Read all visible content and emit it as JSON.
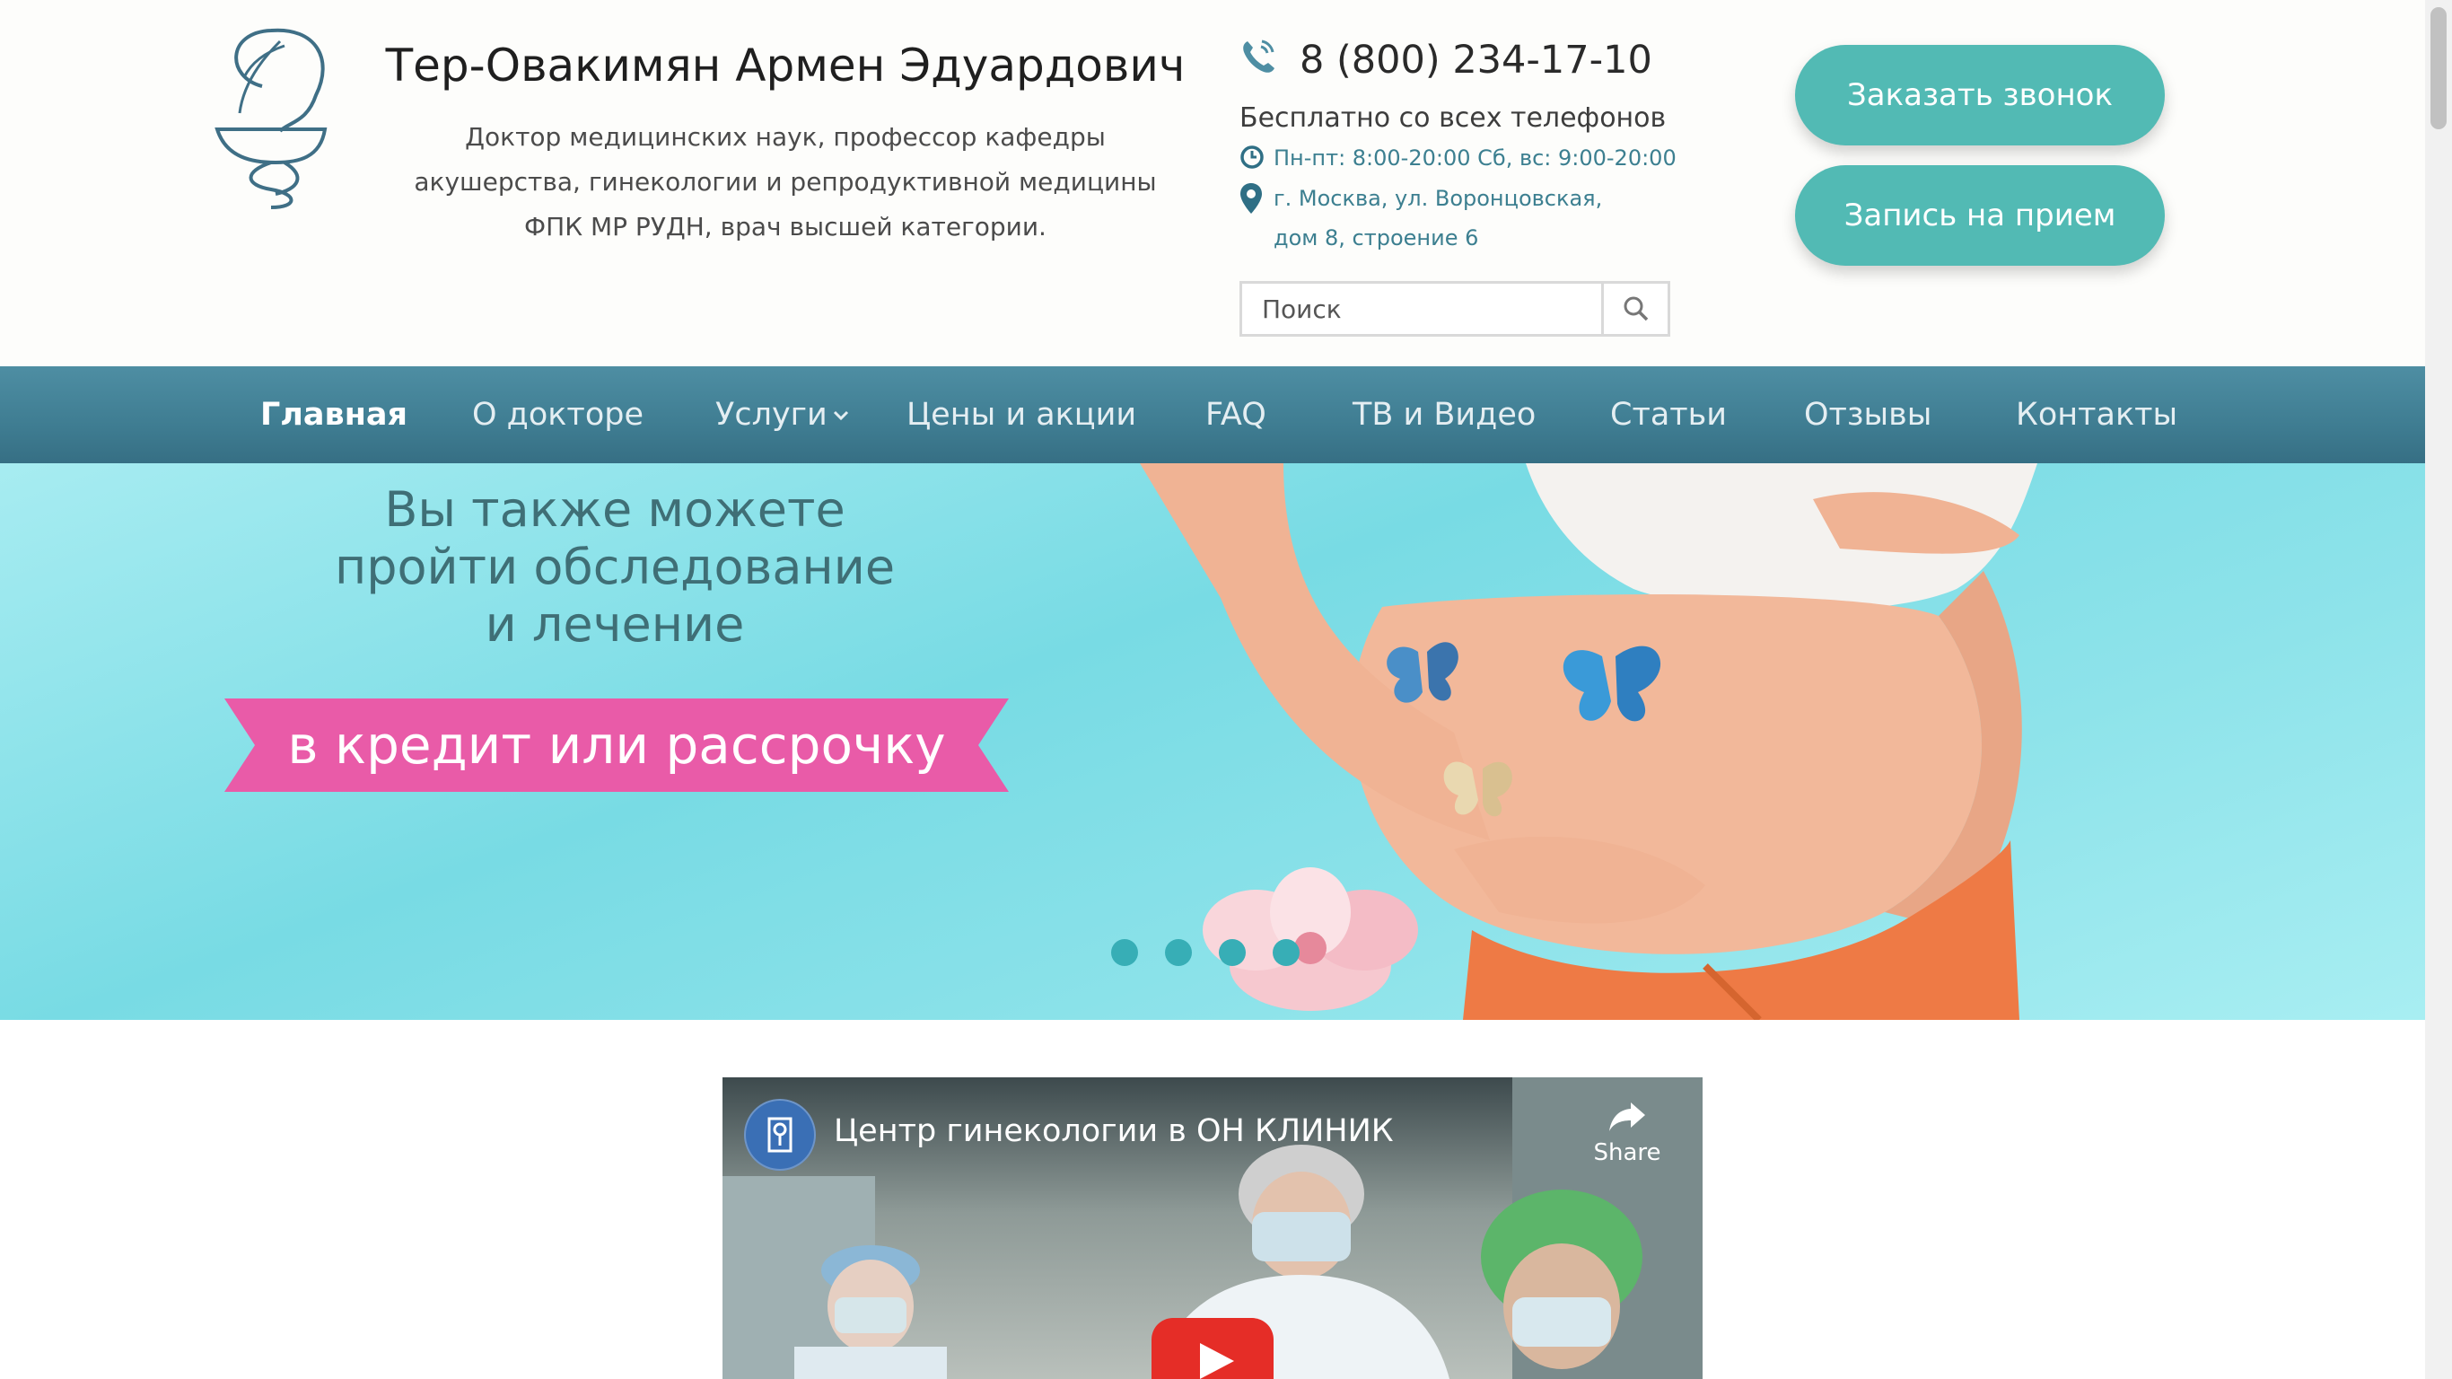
{
  "header": {
    "doctor_name": "Тер-Овакимян Армен Эдуардович",
    "doctor_desc": "Доктор медицинских наук, профессор кафедры акушерства, гинекологии и репродуктивной медицины ФПК МР РУДН, врач высшей категории.",
    "phone": "8 (800) 234-17-10",
    "free_calls": "Бесплатно со всех телефонов",
    "hours": "Пн-пт: 8:00-20:00 Сб, вс: 9:00-20:00",
    "address_line1": "г. Москва, ул. Воронцовская,",
    "address_line2": "дом 8, строение 6",
    "search_placeholder": "Поиск",
    "cta_callback": "Заказать звонок",
    "cta_appointment": "Запись на прием",
    "icons": [
      "logo-icon",
      "phone-icon",
      "clock-icon",
      "location-pin-icon",
      "search-icon"
    ]
  },
  "nav": {
    "items": [
      "Главная",
      "О докторе",
      "Услуги",
      "Цены и акции",
      "FAQ",
      "ТВ и Видео",
      "Статьи",
      "Отзывы",
      "Контакты"
    ],
    "active": "Главная"
  },
  "hero": {
    "line1": "Вы также можете",
    "line2": "пройти обследование",
    "line3": "и лечение",
    "ribbon": "в кредит или рассрочку",
    "slides_count": 4
  },
  "video": {
    "title": "Центр гинекологии в ОН КЛИНИК",
    "share_label": "Share"
  },
  "colors": {
    "accent": "#52bab4",
    "nav_bg": "#3f7d92",
    "link": "#3c7f90",
    "ribbon": "#e95ba8"
  }
}
